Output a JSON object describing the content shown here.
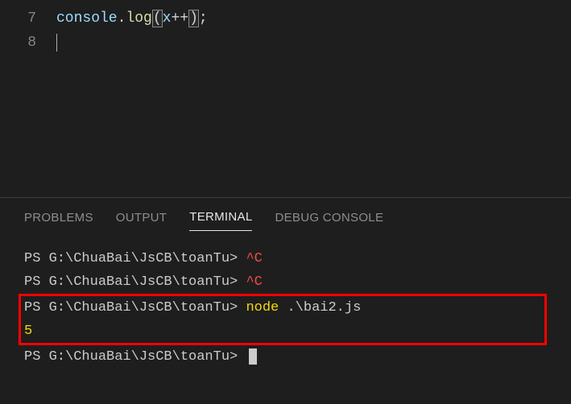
{
  "editor": {
    "lines": [
      {
        "number": "7"
      },
      {
        "number": "8"
      }
    ],
    "code": {
      "object": "console",
      "dot": ".",
      "method": "log",
      "openParen": "(",
      "variable": "x",
      "operator": "++",
      "closeParen": ")",
      "semicolon": ";"
    }
  },
  "panel": {
    "tabs": {
      "problems": "PROBLEMS",
      "output": "OUTPUT",
      "terminal": "TERMINAL",
      "debugConsole": "DEBUG CONSOLE"
    }
  },
  "terminal": {
    "prompt": "PS G:\\ChuaBai\\JsCB\\toanTu>",
    "interruptSignal": "^C",
    "command": "node",
    "commandArg": ".\\bai2.js",
    "output": "5"
  }
}
